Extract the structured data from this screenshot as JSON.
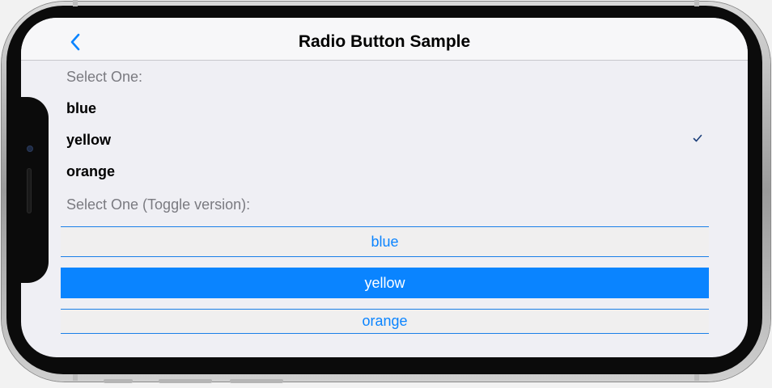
{
  "nav": {
    "title": "Radio Button Sample",
    "back_icon": "chevron-left-icon"
  },
  "radio_group": {
    "label": "Select One:",
    "options": [
      {
        "label": "blue",
        "selected": false
      },
      {
        "label": "yellow",
        "selected": true
      },
      {
        "label": "orange",
        "selected": false
      }
    ]
  },
  "toggle_group": {
    "label": "Select One (Toggle version):",
    "options": [
      {
        "label": "blue",
        "selected": false
      },
      {
        "label": "yellow",
        "selected": true
      },
      {
        "label": "orange",
        "selected": false
      }
    ]
  },
  "colors": {
    "accent": "#0a84ff",
    "screen_bg": "#efeff4",
    "secondary_text": "#7a7a80"
  }
}
